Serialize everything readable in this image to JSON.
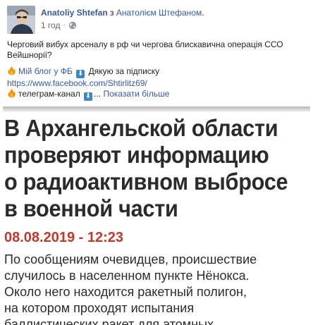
{
  "post": {
    "author": "Anatoliy Shtefan",
    "with_prefix": "з",
    "with_name": "Анатолієм Штефаном",
    "with_suffix": ".",
    "time": "1 год",
    "dot": "·",
    "audience_icon": "globe-icon",
    "text_line1": "Черговий вибух арсеналу в рф чи чергова блискавична операція ССО",
    "text_line2": "Вейшнорії?",
    "blog_label": "Мій блог у ФБ",
    "blog_thanks": "Дякую за підписку",
    "blog_link": "https://www.facebook.com/Shtirlitz69/",
    "telegram_label": "телеграм-канал",
    "ellipsis": "...",
    "see_more": "Показати більше",
    "emoji": {
      "fire": "fire-emoji",
      "down": "down-arrow-emoji"
    },
    "colors": {
      "link": "#385898",
      "meta": "#616770",
      "text": "#1c1e21"
    }
  },
  "attachment": {
    "headline": [
      "В Архангельской области",
      "проверяют информацию",
      "о радиоактивном выбросе",
      "в военной части"
    ],
    "date": "08.08.2019 - 12:23",
    "date_color": "#c0392b",
    "body": [
      "По сообщениям очевидцев, происшествие",
      "случилось в населенном пункте Нёнокса.",
      "Около него находится ракетный полигон,",
      "на котором проходят испытания",
      "баллистических ракет для атомных"
    ]
  }
}
